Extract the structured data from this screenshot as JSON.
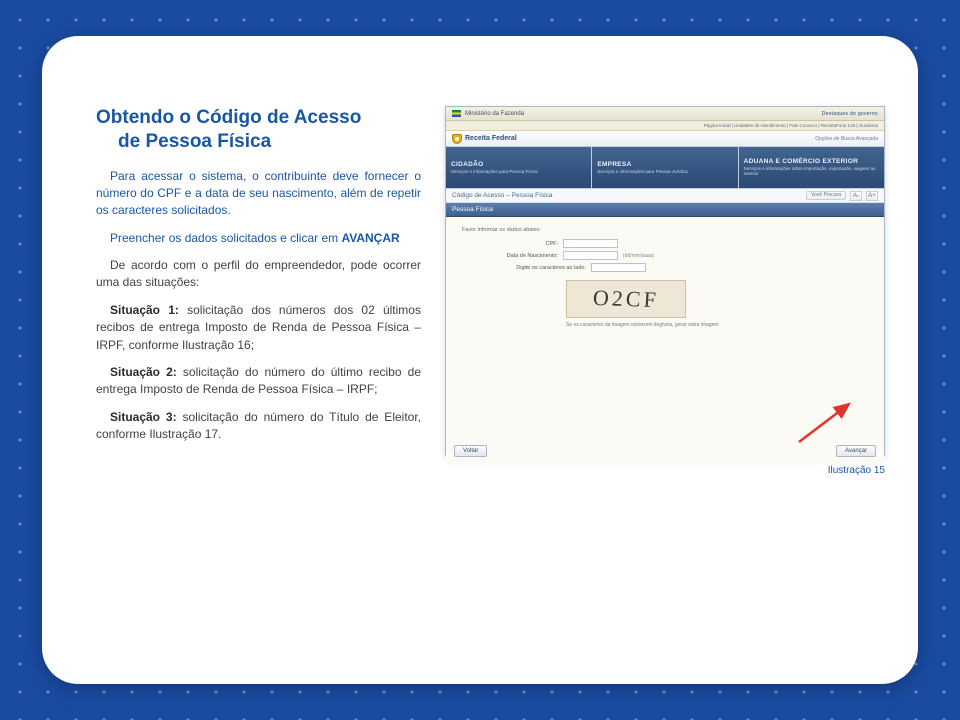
{
  "title": {
    "line1": "Obtendo o Código de Acesso",
    "line2": "de Pessoa Física"
  },
  "p1": {
    "lead": "Para acessar o sistema, o contribuinte deve fornecer o número do CPF e a data de seu nascimento, além de repetir os caracteres solicitados."
  },
  "p2": {
    "a": "Preencher os dados solicitados e clicar em ",
    "avancar": "AVANÇAR"
  },
  "p3": "De acordo com o perfil do empreendedor, pode ocorrer uma das situações:",
  "s1": {
    "label": "Situação 1:",
    "text": " solicitação dos números dos  02 últimos recibos de entrega Imposto de Renda de Pessoa Física – IRPF, conforme Ilustração 16;"
  },
  "s2": {
    "label": "Situação 2:",
    "text": " solicitação do número do  último recibo de entrega Imposto de Renda de Pessoa Física – IRPF;"
  },
  "s3": {
    "label": "Situação 3:",
    "text": " solicitação do número do Título de Eleitor, conforme Ilustração 17."
  },
  "caption": "Ilustração 15",
  "browser": {
    "ministry": "Ministério da Fazenda",
    "destaques": "Destaques do governo",
    "topmenu": "Página Inicial  |  Unidades de Atendimento  |  Fale Conosco  |  ReceitaFone  146  |  Ouvidoria",
    "receita": "Receita Federal",
    "searchAdvLabel": "Opções de Busca Avançada",
    "tabs": [
      {
        "label": "CIDADÃO",
        "sub": "Serviços e informações para Pessoa Física"
      },
      {
        "label": "EMPRESA",
        "sub": "Serviços e informações para Pessoa Jurídica"
      },
      {
        "label": "ADUANA E COMÉRCIO EXTERIOR",
        "sub": "Serviços e informações sobre importação, exportação, viagens ao exterior"
      }
    ],
    "breadcrumb": "Código de Acesso – Pessoa Física",
    "chipVoce": "Você Procura",
    "panel": "Pessoa Física",
    "formHint": "Favor informar os dados abaixo:",
    "rows": {
      "cpf": "CPF:",
      "dob": "Data de Nascimento:",
      "dobNote": "(dd/mm/aaaa)",
      "captcha": "Digite os caracteres ao lado:"
    },
    "captchaText": "O2CF",
    "captchaNote": "Se os caracteres da imagem estiverem ilegíveis, gerar outra imagem",
    "btnBack": "Voltar",
    "btnNext": "Avançar"
  }
}
